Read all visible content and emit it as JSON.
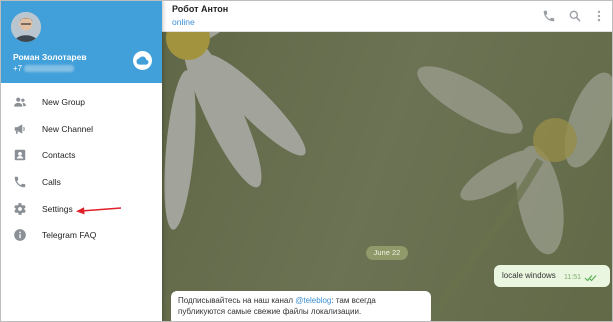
{
  "user": {
    "name": "Роман Золотарев",
    "phone_prefix": "+7"
  },
  "menu": {
    "items": [
      {
        "label": "New Group",
        "icon": "group-icon"
      },
      {
        "label": "New Channel",
        "icon": "megaphone-icon"
      },
      {
        "label": "Contacts",
        "icon": "contact-card-icon"
      },
      {
        "label": "Calls",
        "icon": "phone-icon"
      },
      {
        "label": "Settings",
        "icon": "gear-icon"
      },
      {
        "label": "Telegram FAQ",
        "icon": "info-icon"
      }
    ]
  },
  "chat": {
    "peer_name": "Робот Антон",
    "peer_status": "online",
    "date_separator": "June 22",
    "outgoing": {
      "text": "locale windows",
      "time": "11:51"
    },
    "incoming": {
      "text_before": "Подписывайтесь на наш канал ",
      "link": "@teleblog",
      "text_after": ": там всегда публикуются самые свежие файлы локализации."
    }
  },
  "colors": {
    "accent": "#419fd9",
    "link": "#3a8fd6",
    "annotation_arrow": "#e0202a"
  }
}
